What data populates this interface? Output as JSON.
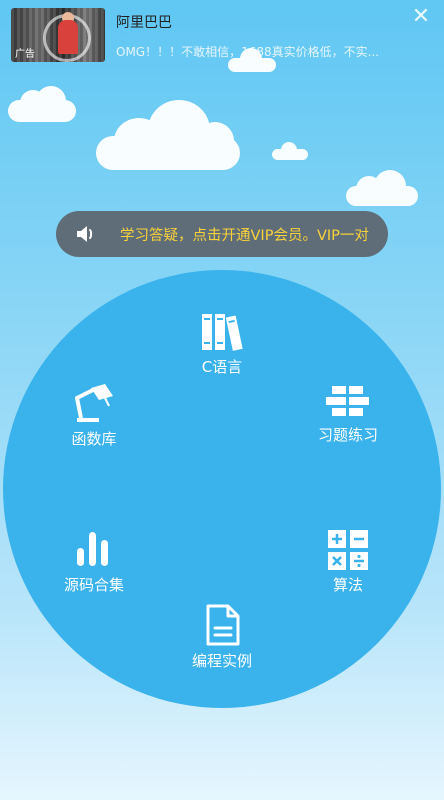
{
  "ad": {
    "thumb_tag": "广告",
    "title": "阿里巴巴",
    "description": "OMG！！！不敢相信，1688真实价格低，不实...",
    "close_icon": "close-icon"
  },
  "notice": {
    "icon": "speaker-icon",
    "text": "学习答疑，点击开通VIP会员。VIP一对"
  },
  "menu": {
    "items": [
      {
        "label": "C语言",
        "icon": "books-icon"
      },
      {
        "label": "函数库",
        "icon": "desk-lamp-icon"
      },
      {
        "label": "习题练习",
        "icon": "bricks-icon"
      },
      {
        "label": "源码合集",
        "icon": "bars-icon"
      },
      {
        "label": "算法",
        "icon": "calculator-icon"
      },
      {
        "label": "编程实例",
        "icon": "document-icon"
      }
    ]
  },
  "colors": {
    "circle": "#3ab3ec",
    "notice_bg": "#5f6d78",
    "notice_text": "#f9d23a"
  }
}
